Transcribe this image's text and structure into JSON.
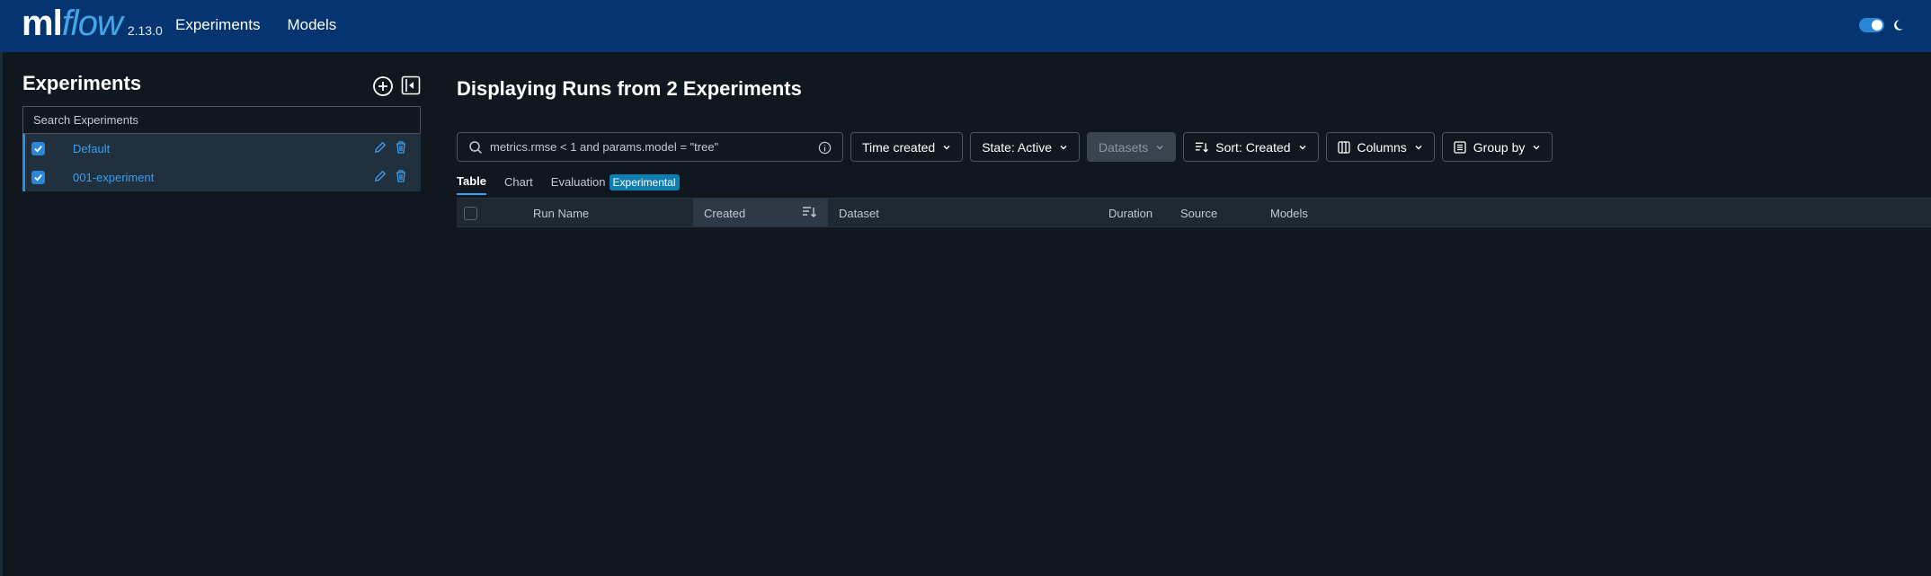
{
  "header": {
    "logo_ml": "ml",
    "logo_flow": "flow",
    "version": "2.13.0",
    "nav": [
      "Experiments",
      "Models"
    ]
  },
  "sidebar": {
    "title": "Experiments",
    "search_placeholder": "Search Experiments",
    "experiments": [
      {
        "name": "Default",
        "checked": true
      },
      {
        "name": "001-experiment",
        "checked": true
      }
    ]
  },
  "main": {
    "title": "Displaying Runs from 2 Experiments",
    "search_value": "metrics.rmse < 1 and params.model = \"tree\"",
    "toolbar": {
      "time_created": "Time created",
      "state": "State: Active",
      "datasets": "Datasets",
      "sort": "Sort: Created",
      "columns": "Columns",
      "group_by": "Group by"
    },
    "tabs": {
      "table": "Table",
      "chart": "Chart",
      "evaluation": "Evaluation",
      "badge": "Experimental"
    },
    "columns": [
      "Run Name",
      "Created",
      "Dataset",
      "Duration",
      "Source",
      "Models"
    ]
  },
  "colors": {
    "header_bg": "#053570",
    "page_bg": "#11171f",
    "accent": "#2a86d6",
    "link": "#3aa0f0"
  }
}
